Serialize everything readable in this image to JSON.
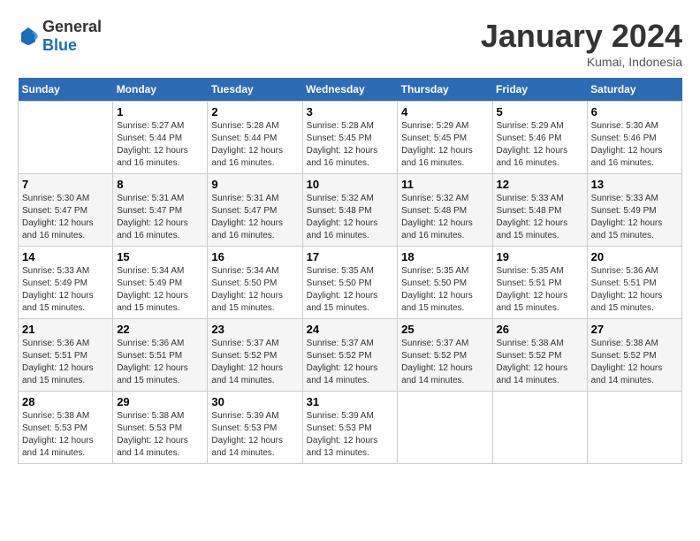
{
  "header": {
    "logo_general": "General",
    "logo_blue": "Blue",
    "month_title": "January 2024",
    "location": "Kumai, Indonesia"
  },
  "days_of_week": [
    "Sunday",
    "Monday",
    "Tuesday",
    "Wednesday",
    "Thursday",
    "Friday",
    "Saturday"
  ],
  "weeks": [
    [
      {
        "day": "",
        "info": ""
      },
      {
        "day": "1",
        "info": "Sunrise: 5:27 AM\nSunset: 5:44 PM\nDaylight: 12 hours and 16 minutes."
      },
      {
        "day": "2",
        "info": "Sunrise: 5:28 AM\nSunset: 5:44 PM\nDaylight: 12 hours and 16 minutes."
      },
      {
        "day": "3",
        "info": "Sunrise: 5:28 AM\nSunset: 5:45 PM\nDaylight: 12 hours and 16 minutes."
      },
      {
        "day": "4",
        "info": "Sunrise: 5:29 AM\nSunset: 5:45 PM\nDaylight: 12 hours and 16 minutes."
      },
      {
        "day": "5",
        "info": "Sunrise: 5:29 AM\nSunset: 5:46 PM\nDaylight: 12 hours and 16 minutes."
      },
      {
        "day": "6",
        "info": "Sunrise: 5:30 AM\nSunset: 5:46 PM\nDaylight: 12 hours and 16 minutes."
      }
    ],
    [
      {
        "day": "7",
        "info": "Sunrise: 5:30 AM\nSunset: 5:47 PM\nDaylight: 12 hours and 16 minutes."
      },
      {
        "day": "8",
        "info": "Sunrise: 5:31 AM\nSunset: 5:47 PM\nDaylight: 12 hours and 16 minutes."
      },
      {
        "day": "9",
        "info": "Sunrise: 5:31 AM\nSunset: 5:47 PM\nDaylight: 12 hours and 16 minutes."
      },
      {
        "day": "10",
        "info": "Sunrise: 5:32 AM\nSunset: 5:48 PM\nDaylight: 12 hours and 16 minutes."
      },
      {
        "day": "11",
        "info": "Sunrise: 5:32 AM\nSunset: 5:48 PM\nDaylight: 12 hours and 16 minutes."
      },
      {
        "day": "12",
        "info": "Sunrise: 5:33 AM\nSunset: 5:48 PM\nDaylight: 12 hours and 15 minutes."
      },
      {
        "day": "13",
        "info": "Sunrise: 5:33 AM\nSunset: 5:49 PM\nDaylight: 12 hours and 15 minutes."
      }
    ],
    [
      {
        "day": "14",
        "info": "Sunrise: 5:33 AM\nSunset: 5:49 PM\nDaylight: 12 hours and 15 minutes."
      },
      {
        "day": "15",
        "info": "Sunrise: 5:34 AM\nSunset: 5:49 PM\nDaylight: 12 hours and 15 minutes."
      },
      {
        "day": "16",
        "info": "Sunrise: 5:34 AM\nSunset: 5:50 PM\nDaylight: 12 hours and 15 minutes."
      },
      {
        "day": "17",
        "info": "Sunrise: 5:35 AM\nSunset: 5:50 PM\nDaylight: 12 hours and 15 minutes."
      },
      {
        "day": "18",
        "info": "Sunrise: 5:35 AM\nSunset: 5:50 PM\nDaylight: 12 hours and 15 minutes."
      },
      {
        "day": "19",
        "info": "Sunrise: 5:35 AM\nSunset: 5:51 PM\nDaylight: 12 hours and 15 minutes."
      },
      {
        "day": "20",
        "info": "Sunrise: 5:36 AM\nSunset: 5:51 PM\nDaylight: 12 hours and 15 minutes."
      }
    ],
    [
      {
        "day": "21",
        "info": "Sunrise: 5:36 AM\nSunset: 5:51 PM\nDaylight: 12 hours and 15 minutes."
      },
      {
        "day": "22",
        "info": "Sunrise: 5:36 AM\nSunset: 5:51 PM\nDaylight: 12 hours and 15 minutes."
      },
      {
        "day": "23",
        "info": "Sunrise: 5:37 AM\nSunset: 5:52 PM\nDaylight: 12 hours and 14 minutes."
      },
      {
        "day": "24",
        "info": "Sunrise: 5:37 AM\nSunset: 5:52 PM\nDaylight: 12 hours and 14 minutes."
      },
      {
        "day": "25",
        "info": "Sunrise: 5:37 AM\nSunset: 5:52 PM\nDaylight: 12 hours and 14 minutes."
      },
      {
        "day": "26",
        "info": "Sunrise: 5:38 AM\nSunset: 5:52 PM\nDaylight: 12 hours and 14 minutes."
      },
      {
        "day": "27",
        "info": "Sunrise: 5:38 AM\nSunset: 5:52 PM\nDaylight: 12 hours and 14 minutes."
      }
    ],
    [
      {
        "day": "28",
        "info": "Sunrise: 5:38 AM\nSunset: 5:53 PM\nDaylight: 12 hours and 14 minutes."
      },
      {
        "day": "29",
        "info": "Sunrise: 5:38 AM\nSunset: 5:53 PM\nDaylight: 12 hours and 14 minutes."
      },
      {
        "day": "30",
        "info": "Sunrise: 5:39 AM\nSunset: 5:53 PM\nDaylight: 12 hours and 14 minutes."
      },
      {
        "day": "31",
        "info": "Sunrise: 5:39 AM\nSunset: 5:53 PM\nDaylight: 12 hours and 13 minutes."
      },
      {
        "day": "",
        "info": ""
      },
      {
        "day": "",
        "info": ""
      },
      {
        "day": "",
        "info": ""
      }
    ]
  ]
}
